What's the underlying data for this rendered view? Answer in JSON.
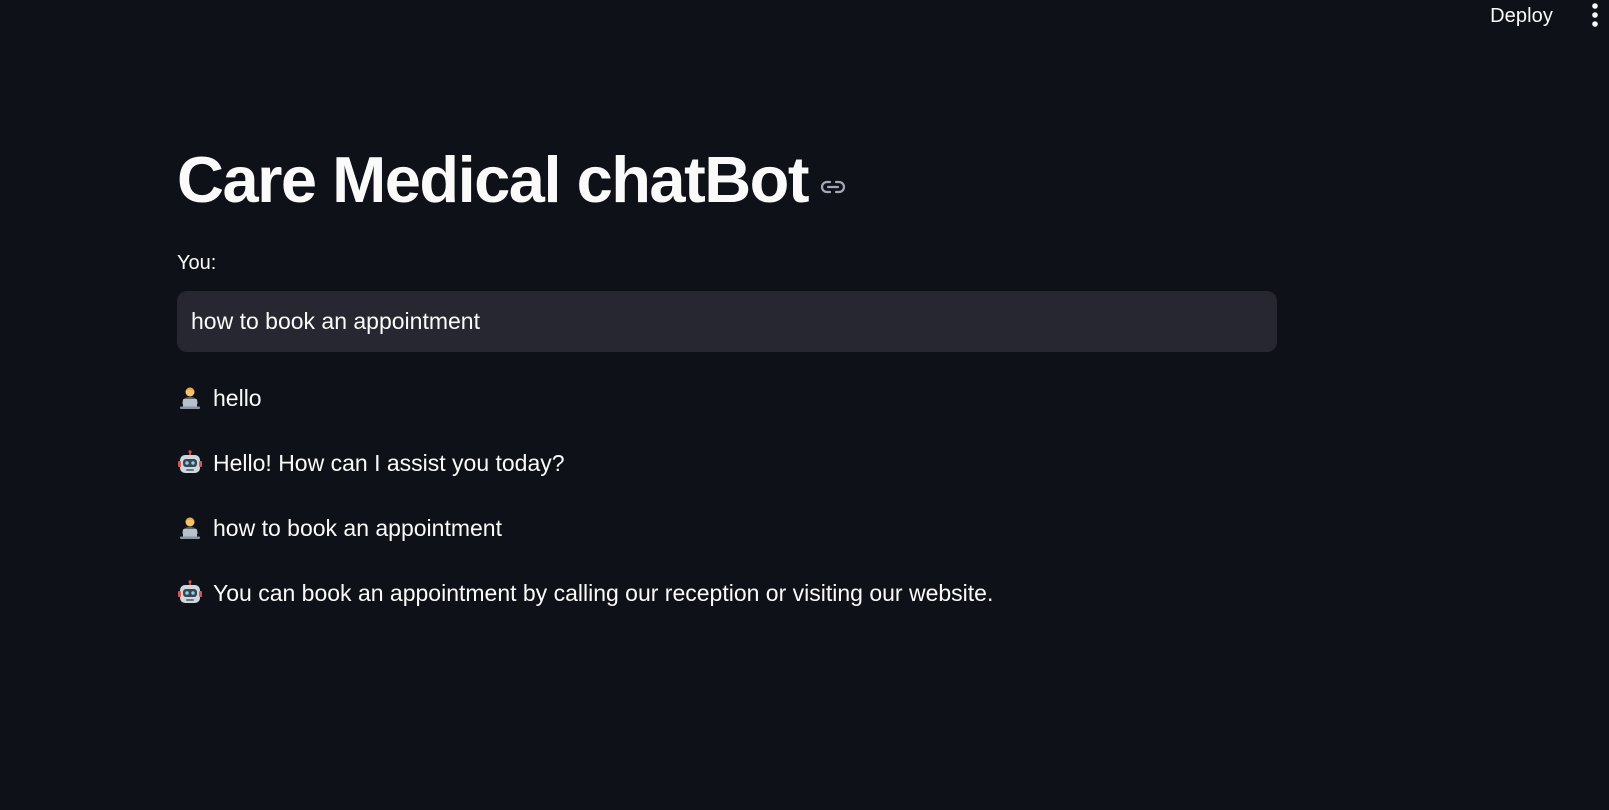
{
  "header": {
    "deploy_label": "Deploy",
    "menu_icon": "more-vertical-icon"
  },
  "main": {
    "title": "Care Medical chatBot",
    "anchor_icon": "link-icon",
    "input": {
      "label": "You:",
      "value": "how to book an appointment"
    },
    "messages": [
      {
        "role": "user",
        "avatar_icon": "person-at-laptop-icon",
        "text": "hello"
      },
      {
        "role": "bot",
        "avatar_icon": "robot-face-icon",
        "text": "Hello! How can I assist you today?"
      },
      {
        "role": "user",
        "avatar_icon": "person-at-laptop-icon",
        "text": "how to book an appointment"
      },
      {
        "role": "bot",
        "avatar_icon": "robot-face-icon",
        "text": "You can book an appointment by calling our reception or visiting our website."
      }
    ]
  },
  "colors": {
    "background": "#0e1117",
    "text": "#fafafa",
    "input_background": "#262730"
  }
}
